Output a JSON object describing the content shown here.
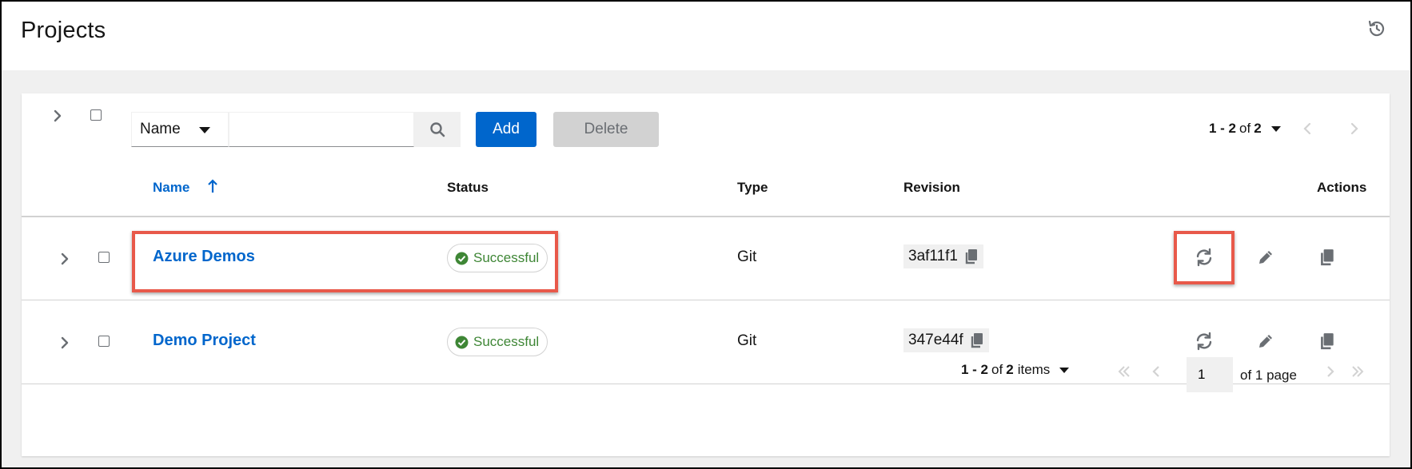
{
  "header": {
    "title": "Projects",
    "history_icon": "history-icon"
  },
  "toolbar": {
    "expand_all_icon": "chevron-right-icon",
    "filter_field": "Name",
    "search_value": "",
    "search_placeholder": "",
    "search_icon": "search-icon",
    "add_label": "Add",
    "delete_label": "Delete",
    "pagination": {
      "range": "1 - 2",
      "of_label": "of",
      "total": "2"
    }
  },
  "table": {
    "columns": {
      "name": "Name",
      "status": "Status",
      "type": "Type",
      "revision": "Revision",
      "actions": "Actions"
    },
    "rows": [
      {
        "name": "Azure Demos",
        "status": "Successful",
        "type": "Git",
        "revision": "3af11f1",
        "highlighted": true,
        "sync_highlighted": true
      },
      {
        "name": "Demo Project",
        "status": "Successful",
        "type": "Git",
        "revision": "347e44f",
        "highlighted": false,
        "sync_highlighted": false
      }
    ]
  },
  "footer_pagination": {
    "range": "1 - 2",
    "of_label": "of",
    "total": "2",
    "items_label": "items",
    "current_page": "1",
    "of_pages_label": "of 1 page"
  },
  "colors": {
    "link": "#0066cc",
    "primary_button": "#0066cc",
    "success": "#3e8635",
    "highlight": "#e8594a"
  }
}
